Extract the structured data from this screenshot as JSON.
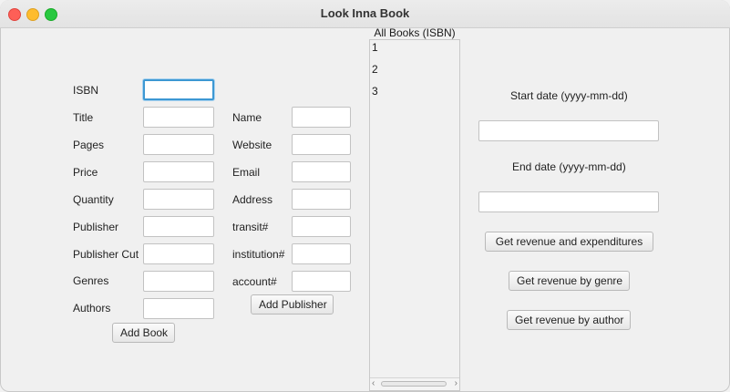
{
  "window": {
    "title": "Look Inna Book"
  },
  "book_form": {
    "isbn_label": "ISBN",
    "title_label": "Title",
    "pages_label": "Pages",
    "price_label": "Price",
    "quantity_label": "Quantity",
    "publisher_label": "Publisher",
    "publisher_cut_label": "Publisher Cut",
    "genres_label": "Genres",
    "authors_label": "Authors",
    "add_button": "Add Book"
  },
  "publisher_form": {
    "name_label": "Name",
    "website_label": "Website",
    "email_label": "Email",
    "address_label": "Address",
    "transit_label": "transit#",
    "institution_label": "institution#",
    "account_label": "account#",
    "add_button": "Add Publisher"
  },
  "books_list": {
    "title": "All Books (ISBN)",
    "items": [
      "1",
      "2",
      "3"
    ]
  },
  "reports": {
    "start_label": "Start date (yyyy-mm-dd)",
    "end_label": "End date (yyyy-mm-dd)",
    "revenue_expenditures_button": "Get revenue and expenditures",
    "revenue_genre_button": "Get revenue by genre",
    "revenue_author_button": "Get revenue by author"
  }
}
